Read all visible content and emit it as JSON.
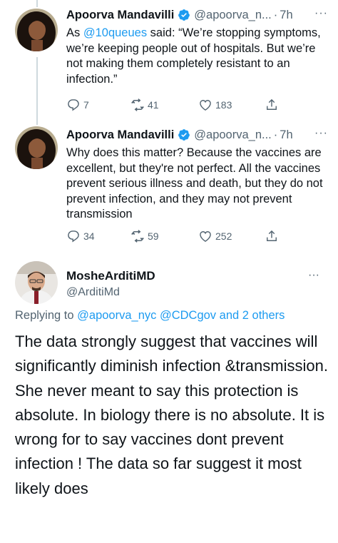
{
  "tweets": [
    {
      "author_name": "Apoorva Mandavilli",
      "author_handle": "@apoorva_n...",
      "time": "7h",
      "more_icon": "more-horizontal-icon",
      "text_prefix": "As ",
      "mention": "@10queues",
      "text_rest": " said: “We’re stopping symptoms, we’re keeping people out of hospitals. But we’re not making them completely resistant to an infection.”",
      "replies": "7",
      "retweets": "41",
      "likes": "183"
    },
    {
      "author_name": "Apoorva Mandavilli",
      "author_handle": "@apoorva_n...",
      "time": "7h",
      "more_icon": "more-horizontal-icon",
      "text": "Why does this matter? Because the vaccines are excellent, but they're not perfect. All the vaccines prevent serious illness and death, but they do not prevent infection, and they may not prevent transmission",
      "replies": "34",
      "retweets": "59",
      "likes": "252"
    }
  ],
  "main_tweet": {
    "author_name": "MosheArditiMD",
    "author_handle": "@ArditiMd",
    "replying_prefix": "Replying to ",
    "replying_to": "@apoorva_nyc @CDCgov and 2 others",
    "text": "The data strongly suggest that vaccines will significantly diminish infection &transmission. She never meant to say this protection is absolute. In biology there is no absolute. It is wrong for to say vaccines dont prevent infection ! The data so far suggest it most likely does"
  },
  "separator": "·",
  "more_glyph": "···",
  "colors": {
    "accent": "#1d9bf0",
    "secondary_text": "#536471",
    "primary_text": "#0f1419",
    "verified": "#1d9bf0"
  }
}
